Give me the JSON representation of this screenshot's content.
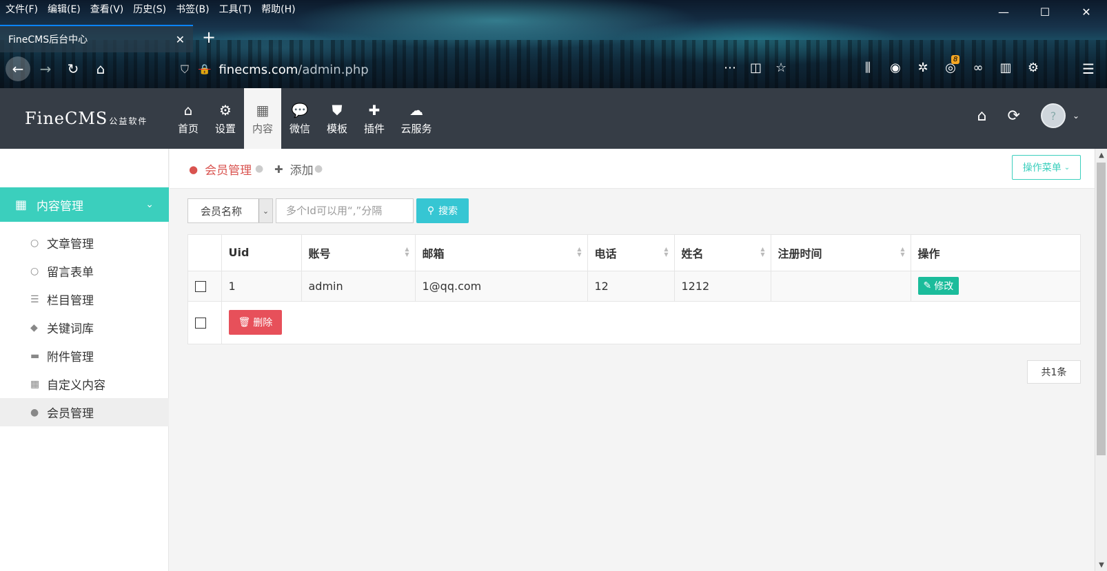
{
  "browser": {
    "menu": [
      "文件(F)",
      "编辑(E)",
      "查看(V)",
      "历史(S)",
      "书签(B)",
      "工具(T)",
      "帮助(H)"
    ],
    "window_controls": {
      "minimize": "—",
      "maximize": "☐",
      "close": "✕"
    },
    "tab_title": "FineCMS后台中心",
    "tab_close": "✕",
    "new_tab": "+",
    "url_host": "finecms.com",
    "url_path": "/admin.php",
    "extension_badge": "8"
  },
  "header": {
    "logo": "FineCMS",
    "logo_sub": "公益软件",
    "nav": [
      {
        "label": "首页",
        "icon": "home-icon"
      },
      {
        "label": "设置",
        "icon": "gear-icon"
      },
      {
        "label": "内容",
        "icon": "grid-icon"
      },
      {
        "label": "微信",
        "icon": "wechat-icon"
      },
      {
        "label": "模板",
        "icon": "html5-icon"
      },
      {
        "label": "插件",
        "icon": "puzzle-icon"
      },
      {
        "label": "云服务",
        "icon": "cloud-icon"
      }
    ],
    "active_nav": "内容"
  },
  "sidebar": {
    "section": "内容管理",
    "items": [
      {
        "label": "文章管理",
        "icon": "circle-icon"
      },
      {
        "label": "留言表单",
        "icon": "circle-icon"
      },
      {
        "label": "栏目管理",
        "icon": "list-icon"
      },
      {
        "label": "关键词库",
        "icon": "tag-icon"
      },
      {
        "label": "附件管理",
        "icon": "folder-icon"
      },
      {
        "label": "自定义内容",
        "icon": "grid-icon"
      },
      {
        "label": "会员管理",
        "icon": "user-icon"
      }
    ],
    "active_item": "会员管理"
  },
  "breadcrumb": {
    "current": "会员管理",
    "add": "添加",
    "op_menu": "操作菜单"
  },
  "search": {
    "field_selected": "会员名称",
    "placeholder": "多个Id可以用“,”分隔",
    "button": "搜索"
  },
  "table": {
    "columns": [
      "Uid",
      "账号",
      "邮箱",
      "电话",
      "姓名",
      "注册时间",
      "操作"
    ],
    "rows": [
      {
        "uid": "1",
        "account": "admin",
        "email": "1@qq.com",
        "phone": "12",
        "name": "1212",
        "reg_time": "",
        "action": "修改"
      }
    ],
    "delete_button": "删除"
  },
  "pager": {
    "total": "共1条"
  },
  "colors": {
    "accent": "#3bcfbd",
    "search": "#36c6d3",
    "edit": "#1bbc9b",
    "delete": "#e7505a",
    "header_bg": "#363d46"
  }
}
